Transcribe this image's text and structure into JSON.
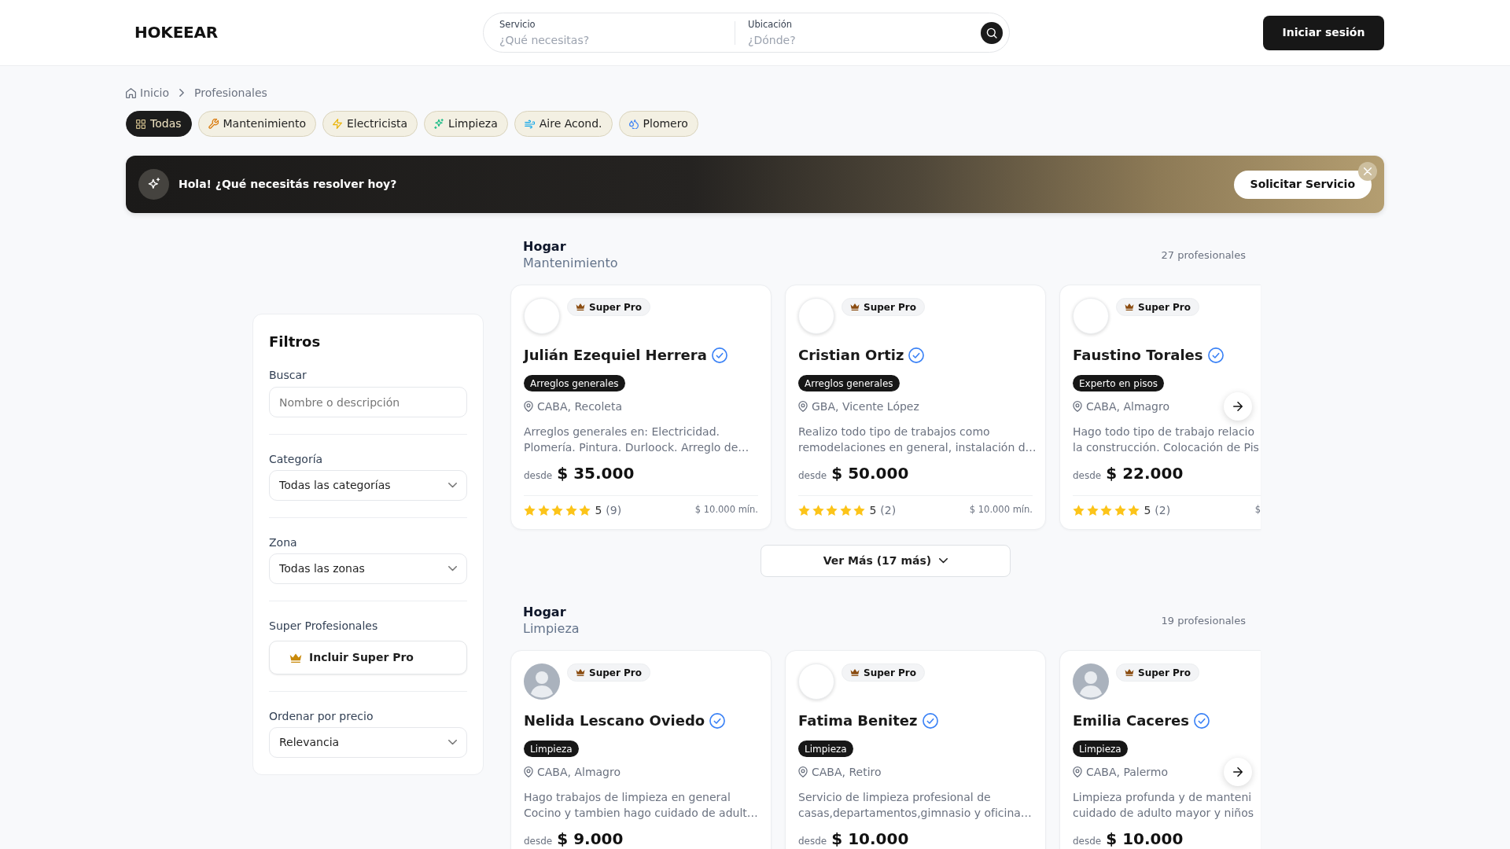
{
  "header": {
    "logo": "HOKEEAR",
    "search_fields": [
      {
        "label": "Servicio",
        "placeholder": "¿Qué necesitas?"
      },
      {
        "label": "Ubicación",
        "placeholder": "¿Dónde?"
      }
    ],
    "login_button": "Iniciar sesión"
  },
  "breadcrumb": [
    {
      "label": "Inicio"
    },
    {
      "label": "Profesionales"
    }
  ],
  "categories": [
    {
      "label": "Todas",
      "selected": true
    },
    {
      "label": "Mantenimiento",
      "selected": false
    },
    {
      "label": "Electricista",
      "selected": false
    },
    {
      "label": "Limpieza",
      "selected": false
    },
    {
      "label": "Aire Acond.",
      "selected": false
    },
    {
      "label": "Plomero",
      "selected": false
    }
  ],
  "banner": {
    "message": "Hola! ¿Qué necesitás resolver hoy?",
    "button": "Solicitar Servicio"
  },
  "filters": {
    "title": "Filtros",
    "fields": [
      {
        "kind": "input",
        "label": "Buscar",
        "placeholder": "Nombre o descripción"
      },
      {
        "kind": "select",
        "label": "Categoría",
        "value": "Todas las categorías"
      },
      {
        "kind": "select",
        "label": "Zona",
        "value": "Todas las zonas"
      },
      {
        "kind": "toggle",
        "label": "Super Profesionales",
        "button": "Incluir Super Pro",
        "on": false
      },
      {
        "kind": "select",
        "label": "Ordenar por precio",
        "value": "Relevancia"
      }
    ]
  },
  "sections": [
    {
      "title": "Hogar",
      "subtitle": "Mantenimiento",
      "count": "27 profesionales",
      "cards": [
        {
          "photo": false,
          "badge": "Super Pro",
          "name": "Julián Ezequiel Herrera",
          "verified": true,
          "tag": "Arreglos generales",
          "location": "CABA, Recoleta",
          "description": [
            "Arreglos generales en: Electricidad.",
            "Plomería. Pintura. Durloock. Arreglo de…"
          ],
          "price_prefix": "desde",
          "price": "$ 35.000",
          "stars": 5,
          "rating": "5",
          "reviews": "(9)",
          "min_price": "$ 10.000 mín."
        },
        {
          "photo": false,
          "badge": "Super Pro",
          "name": "Cristian Ortiz",
          "verified": true,
          "tag": "Arreglos generales",
          "location": "GBA, Vicente López",
          "description": [
            "Realizo todo tipo de trabajos como",
            "remodelaciones en general, instalación d…"
          ],
          "price_prefix": "desde",
          "price": "$ 50.000",
          "stars": 5,
          "rating": "5",
          "reviews": "(2)",
          "min_price": "$ 10.000 mín."
        },
        {
          "photo": false,
          "badge": "Super Pro",
          "name": "Faustino Torales",
          "verified": true,
          "tag": "Experto en pisos",
          "location": "CABA, Almagro",
          "description": [
            "Hago todo tipo de trabajo relacio",
            "la construcción. Colocación de Pis"
          ],
          "price_prefix": "desde",
          "price": "$ 22.000",
          "stars": 5,
          "rating": "5",
          "reviews": "(2)",
          "min_price": "$"
        }
      ],
      "more_button": "Ver Más (17 más)"
    },
    {
      "title": "Hogar",
      "subtitle": "Limpieza",
      "count": "19 profesionales",
      "cards": [
        {
          "photo": true,
          "badge": "Super Pro",
          "name": "Nelida Lescano Oviedo",
          "verified": true,
          "tag": "Limpieza",
          "location": "CABA, Almagro",
          "description": [
            "Hago trabajos de limpieza en general",
            "Cocino y tambien hago cuidado de adult…"
          ],
          "price_prefix": "desde",
          "price": "$ 9.000"
        },
        {
          "photo": false,
          "badge": "Super Pro",
          "name": "Fatima Benitez",
          "verified": true,
          "tag": "Limpieza",
          "location": "CABA, Retiro",
          "description": [
            "Servicio de limpieza profesional de",
            "casas,departamentos,gimnasio y oficina…"
          ],
          "price_prefix": "desde",
          "price": "$ 10.000"
        },
        {
          "photo": true,
          "badge": "Super Pro",
          "name": "Emilia Caceres",
          "verified": true,
          "tag": "Limpieza",
          "location": "CABA, Palermo",
          "description": [
            "Limpieza profunda y de manteni",
            "cuidado de adulto mayor y niños"
          ],
          "price_prefix": "desde",
          "price": "$ 10.000"
        }
      ]
    }
  ]
}
